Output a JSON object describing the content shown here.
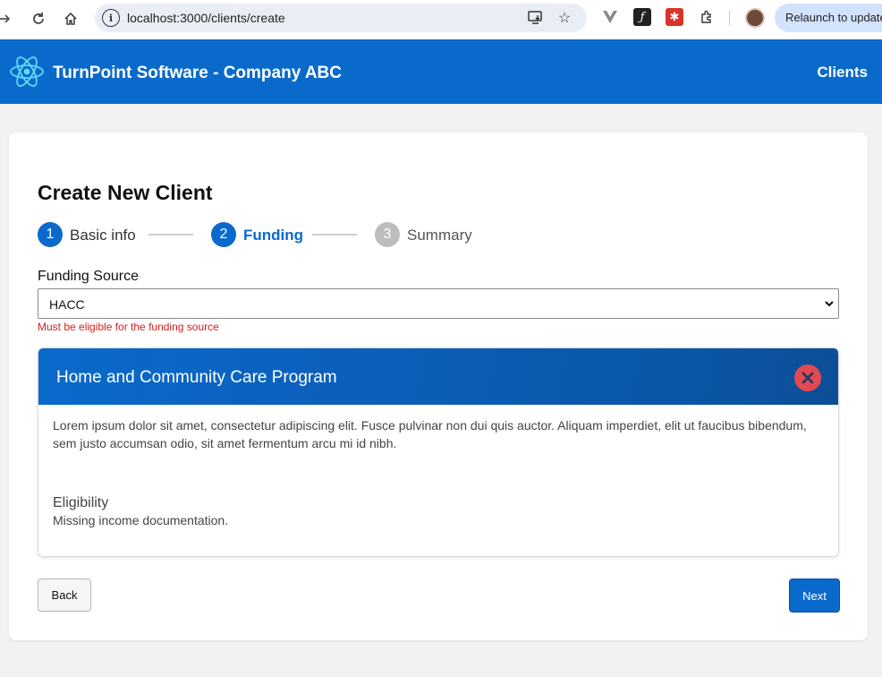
{
  "browser": {
    "url": "localhost:3000/clients/create",
    "relaunch_label": "Relaunch to update"
  },
  "header": {
    "title": "TurnPoint Software - Company ABC",
    "nav_clients": "Clients",
    "brand_color": "#0a6acc"
  },
  "page": {
    "title": "Create New Client"
  },
  "stepper": {
    "steps": [
      {
        "number": "1",
        "label": "Basic info",
        "state": "complete"
      },
      {
        "number": "2",
        "label": "Funding",
        "state": "active"
      },
      {
        "number": "3",
        "label": "Summary",
        "state": "pending"
      }
    ],
    "active_color": "#0a6acc",
    "pending_color": "#bdbdbd"
  },
  "form": {
    "funding_label": "Funding Source",
    "funding_value": "HACC",
    "error": "Must be eligible for the funding source"
  },
  "program": {
    "title": "Home and Community Care Program",
    "description": "Lorem ipsum dolor sit amet, consectetur adipiscing elit. Fusce pulvinar non dui quis auctor. Aliquam imperdiet, elit ut faucibus bibendum, sem justo accumsan odio, sit amet fermentum arcu mi id nibh.",
    "eligibility_label": "Eligibility",
    "eligibility_value": "Missing income documentation.",
    "status_color": "#e04a50"
  },
  "actions": {
    "back": "Back",
    "next": "Next"
  }
}
